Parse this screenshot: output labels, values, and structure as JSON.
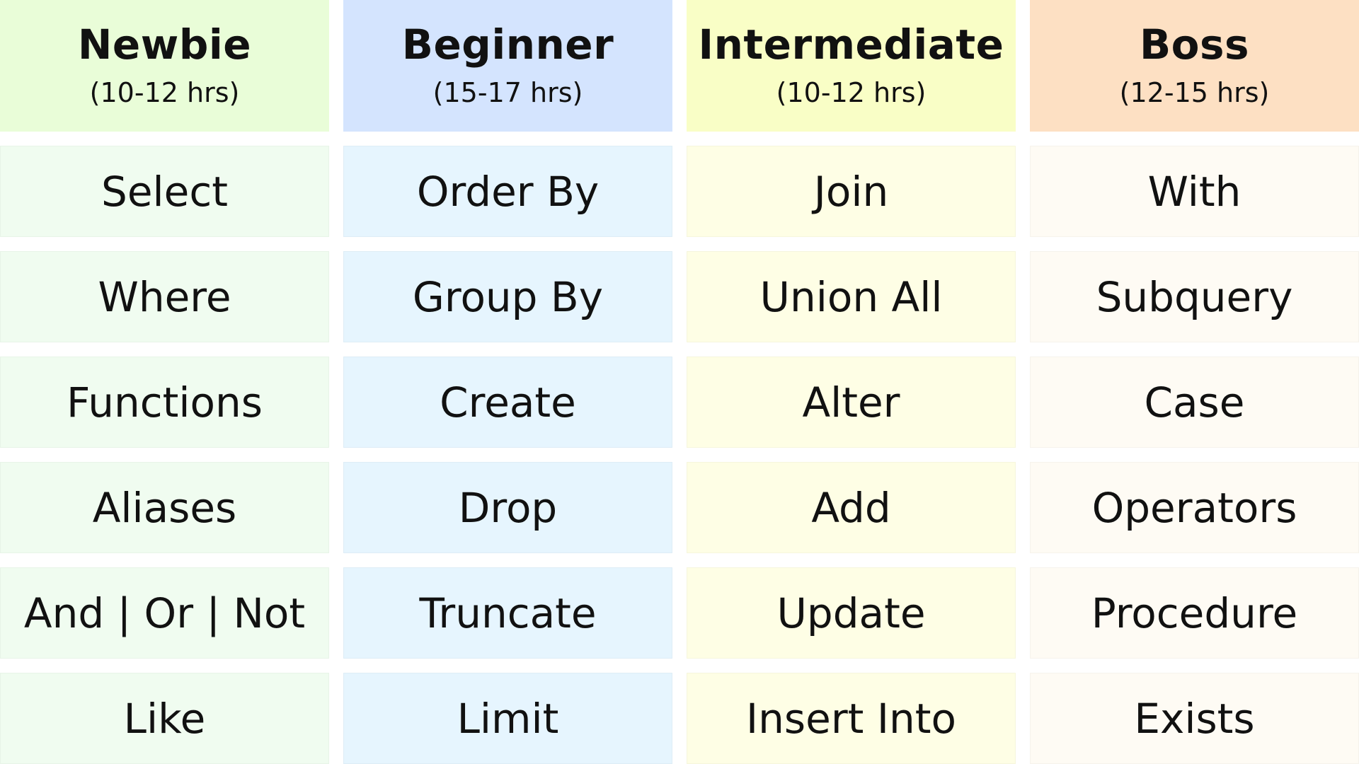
{
  "columns": [
    {
      "title": "Newbie",
      "hours": "(10-12 hrs)",
      "header_color": "#e9fdd8",
      "cell_color": "#f0fcf0",
      "items": [
        "Select",
        "Where",
        "Functions",
        "Aliases",
        "And | Or | Not",
        "Like"
      ]
    },
    {
      "title": "Beginner",
      "hours": "(15-17 hrs)",
      "header_color": "#d4e4fe",
      "cell_color": "#e6f5fe",
      "items": [
        "Order By",
        "Group By",
        "Create",
        "Drop",
        "Truncate",
        "Limit"
      ]
    },
    {
      "title": "Intermediate",
      "hours": "(10-12 hrs)",
      "header_color": "#f9fec6",
      "cell_color": "#fefee5",
      "items": [
        "Join",
        "Union All",
        "Alter",
        "Add",
        "Update",
        "Insert Into"
      ]
    },
    {
      "title": "Boss",
      "hours": "(12-15 hrs)",
      "header_color": "#fde0c3",
      "cell_color": "#fefbf4",
      "items": [
        "With",
        "Subquery",
        "Case",
        "Operators",
        "Procedure",
        "Exists"
      ]
    }
  ]
}
